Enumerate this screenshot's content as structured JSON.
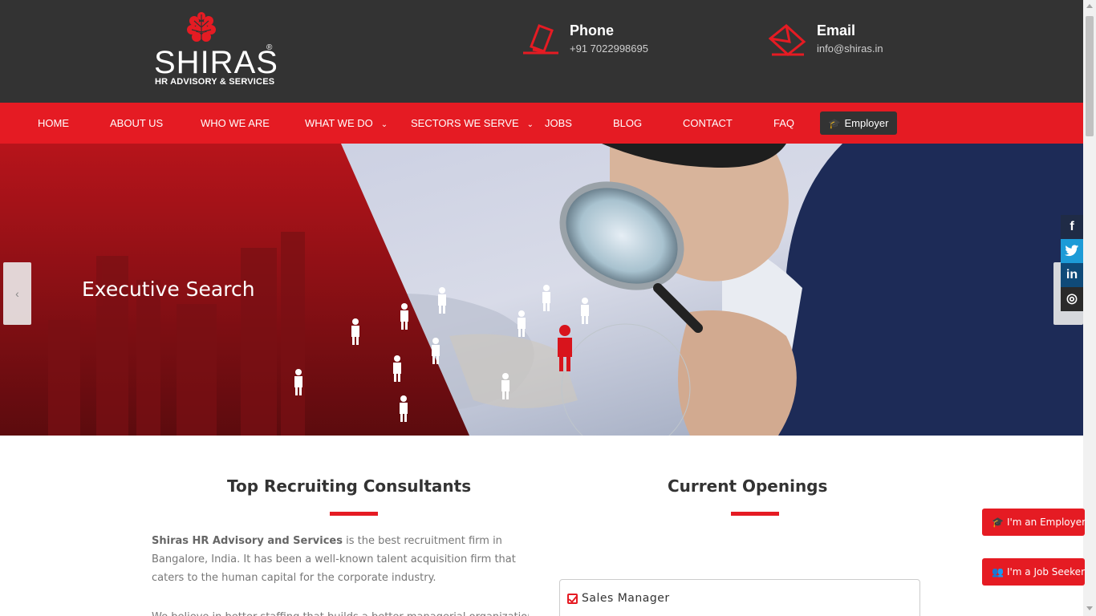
{
  "header": {
    "logo": {
      "name": "SHIRAS",
      "registered": "®",
      "tagline": "HR ADVISORY & SERVICES"
    },
    "phone": {
      "title": "Phone",
      "value": "+91 7022998695",
      "icon": "phone-icon"
    },
    "email": {
      "title": "Email",
      "value": "info@shiras.in",
      "icon": "envelope-icon"
    }
  },
  "nav": {
    "items": [
      {
        "label": "HOME"
      },
      {
        "label": "ABOUT US"
      },
      {
        "label": "WHO WE ARE"
      },
      {
        "label": "WHAT WE DO",
        "dropdown": true
      },
      {
        "label": "SECTORS WE SERVE",
        "dropdown": true
      },
      {
        "label": "JOBS"
      },
      {
        "label": "BLOG"
      },
      {
        "label": "CONTACT"
      },
      {
        "label": "FAQ"
      }
    ],
    "employer_button": {
      "label": "Employer",
      "icon": "graduation-cap-icon"
    }
  },
  "hero": {
    "caption": "Executive Search",
    "prev": "‹"
  },
  "social": [
    {
      "name": "facebook",
      "glyph": "f"
    },
    {
      "name": "twitter",
      "glyph": "t"
    },
    {
      "name": "linkedin",
      "glyph": "in"
    },
    {
      "name": "instagram",
      "glyph": "◎"
    }
  ],
  "main": {
    "left": {
      "title": "Top Recruiting Consultants",
      "intro_bold": "Shiras HR Advisory and Services",
      "intro_rest_1": " is the best recruitment firm in",
      "intro_line_2": "Bangalore, India. It has been a well-known talent acquisition firm that",
      "intro_line_3": "caters to the human capital for the corporate industry.",
      "intro_2": "We believe in better staffing that builds a better managerial organization"
    },
    "right": {
      "title": "Current Openings",
      "openings": [
        {
          "title": "Sales Manager"
        }
      ]
    }
  },
  "floating": {
    "employer": "I'm an Employer",
    "seeker": "I'm a Job Seeker"
  },
  "colors": {
    "brand_red": "#e51b23",
    "header_dark": "#333333"
  }
}
